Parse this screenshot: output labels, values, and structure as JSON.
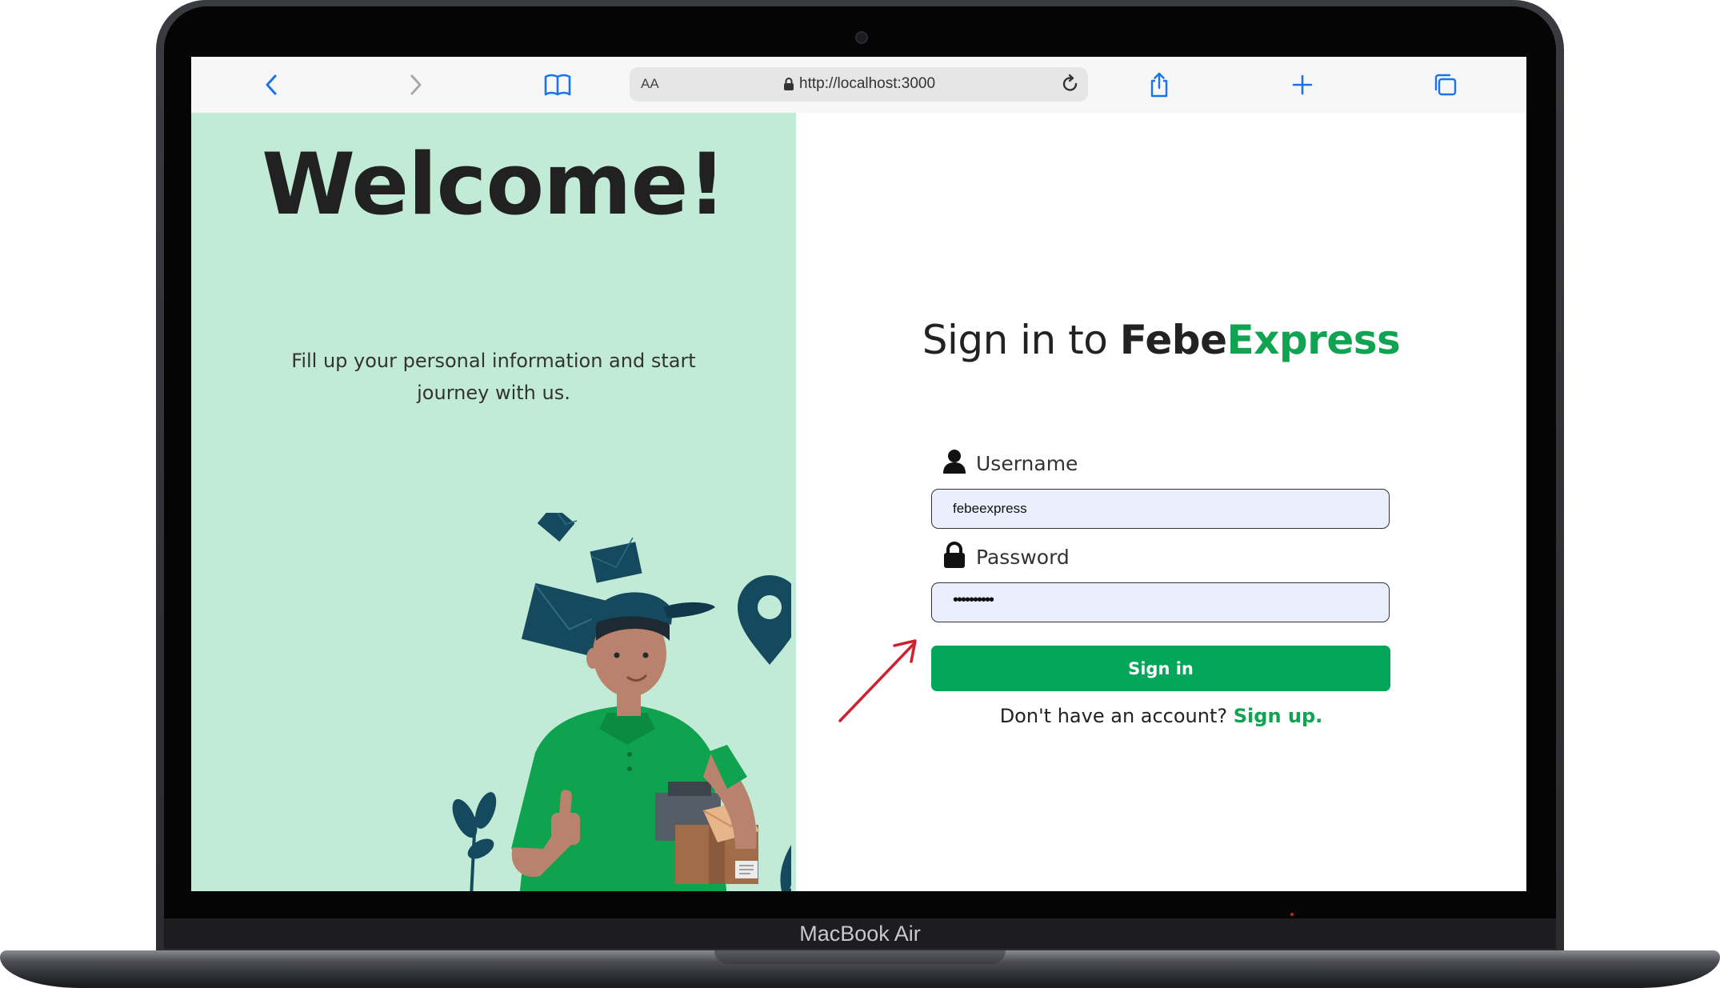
{
  "device": {
    "brand_label": "MacBook Air"
  },
  "browser": {
    "reader_label": "AA",
    "url": "http://localhost:3000",
    "icons": [
      "back-icon",
      "forward-icon",
      "bookmarks-icon",
      "lock-icon",
      "reload-icon",
      "share-icon",
      "new-tab-icon",
      "tabs-icon"
    ]
  },
  "hero": {
    "title": "Welcome!",
    "tagline_line1": "Fill up your personal information and start",
    "tagline_line2": "journey with us."
  },
  "form": {
    "title_prefix": "Sign in to ",
    "brand_part1": "Febe",
    "brand_part2": "Express",
    "username_label": "Username",
    "username_value": "febeexpress",
    "password_label": "Password",
    "password_value": "••••••••••",
    "submit_label": "Sign in",
    "signup_prompt": "Don't have an account? ",
    "signup_link": "Sign up."
  },
  "colors": {
    "brand_green": "#10a352",
    "button_green": "#04a759",
    "panel_mint": "#c2ebd7",
    "input_fill": "#e9effd",
    "annotation_red": "#d0202e"
  }
}
